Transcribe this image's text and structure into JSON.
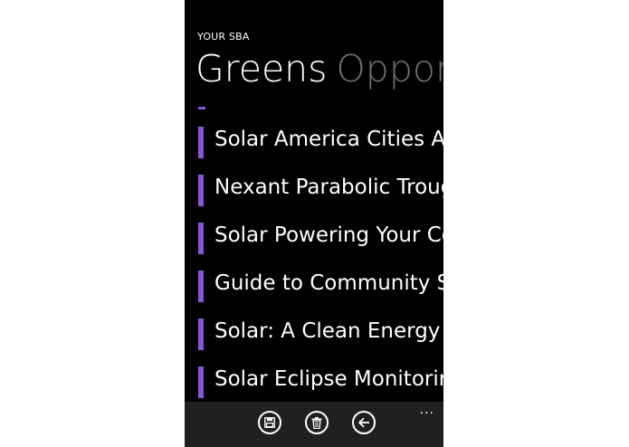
{
  "app": {
    "title": "YOUR SBA"
  },
  "pivot": {
    "active": "Greens",
    "next": "Opport"
  },
  "list": {
    "items": [
      {
        "label": "Solar America Cities Av"
      },
      {
        "label": "Nexant Parabolic Troug"
      },
      {
        "label": "Solar Powering Your Co"
      },
      {
        "label": "Guide to Community S"
      },
      {
        "label": "Solar: A Clean Energy"
      },
      {
        "label": "Solar Eclipse Monitorir"
      }
    ]
  },
  "appbar": {
    "buttons": [
      {
        "icon": "save-icon"
      },
      {
        "icon": "delete-icon"
      },
      {
        "icon": "back-icon"
      }
    ],
    "more_label": "..."
  },
  "colors": {
    "accent": "#8a55d6",
    "background": "#000000",
    "appbar": "#202020",
    "inactive": "#6f6f6f"
  }
}
